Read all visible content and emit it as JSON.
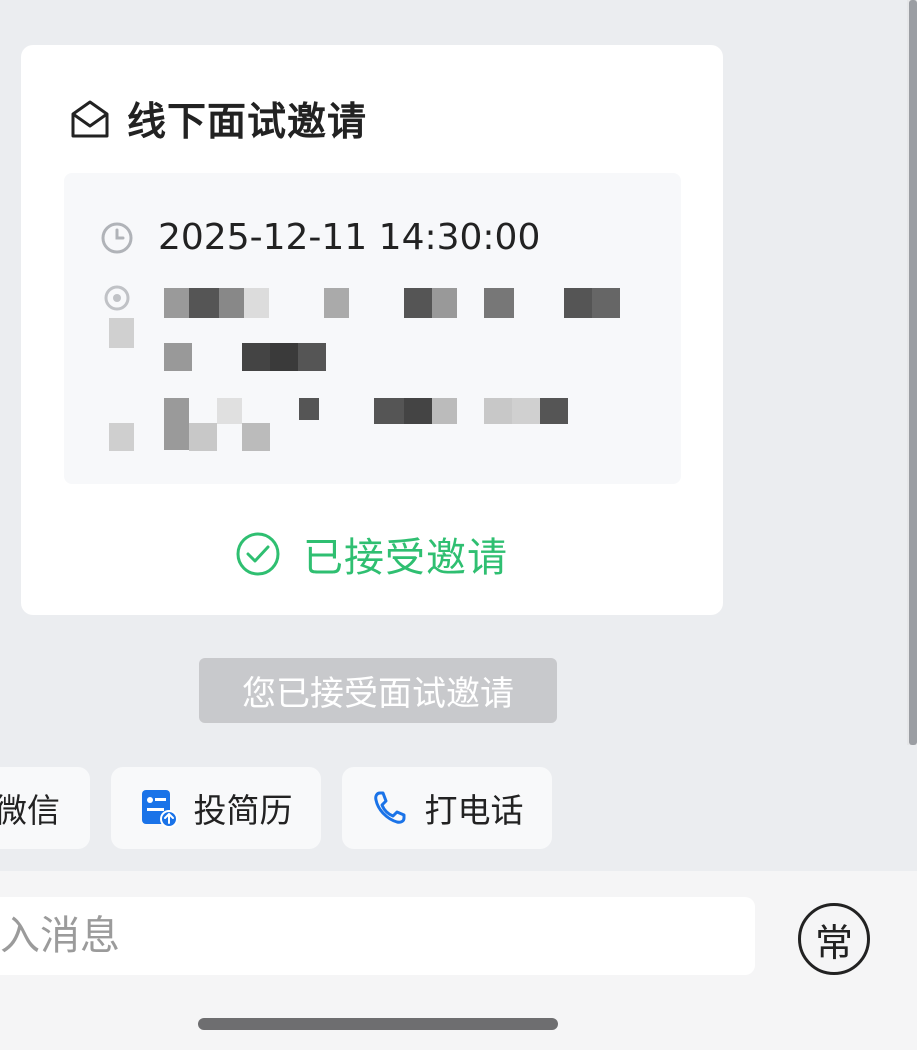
{
  "invite_card": {
    "title": "线下面试邀请",
    "title_icon": "envelope-open-icon",
    "interview_time": "2025-12-11 14:30:00",
    "time_icon": "clock-icon",
    "location_icon": "location-pin-icon",
    "status_label": "已接受邀请",
    "status_icon": "check-circle-icon",
    "status_color": "#2fbf71"
  },
  "system_notice": "您已接受面试邀请",
  "quick_actions": [
    {
      "label": "微信",
      "icon": ""
    },
    {
      "label": "投简历",
      "icon": "resume-upload-icon",
      "accent": "#1a73e8"
    },
    {
      "label": "打电话",
      "icon": "phone-icon",
      "accent": "#1a73e8"
    }
  ],
  "input_bar": {
    "placeholder": "入消息",
    "common_phrase_label": "常"
  }
}
